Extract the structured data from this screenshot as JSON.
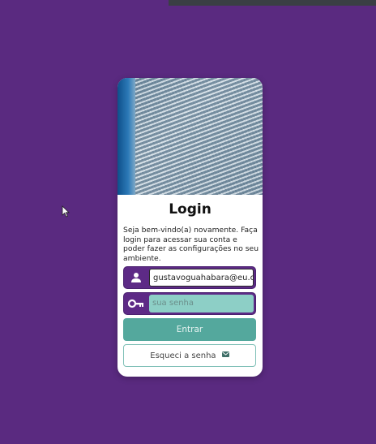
{
  "login": {
    "title": "Login",
    "description": "Seja bem-vindo(a) novamente. Faça login para acessar sua conta e poder fazer as configurações no seu ambiente.",
    "email": {
      "value": "gustavoguahabara@eu.com",
      "icon": "user-icon"
    },
    "password": {
      "placeholder": "sua senha",
      "icon": "key-icon"
    },
    "submit_label": "Entrar",
    "forgot_label": "Esqueci a senha",
    "forgot_icon": "mail-icon"
  },
  "colors": {
    "background": "#5a2a80",
    "field_accent": "#5d2a86",
    "primary_button": "#54a89d",
    "password_fill": "#8dcfc6"
  }
}
